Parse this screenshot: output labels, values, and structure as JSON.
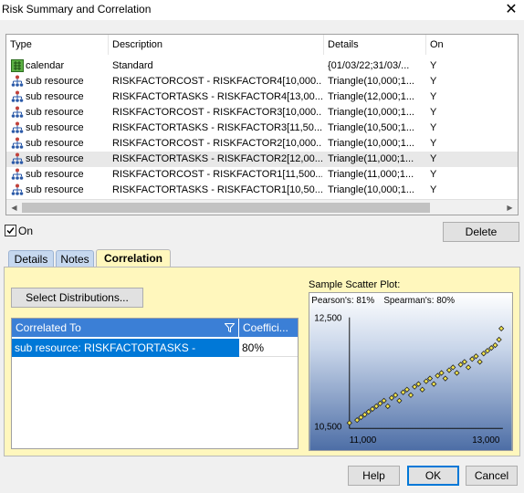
{
  "window": {
    "title": "Risk Summary and Correlation",
    "close_glyph": "✕"
  },
  "table": {
    "columns": [
      "Type",
      "Description",
      "Details",
      "On"
    ],
    "rows": [
      {
        "type": "calendar",
        "icon": "calendar-icon",
        "description": "Standard",
        "details": "{01/03/22;31/03/...",
        "on": "Y"
      },
      {
        "type": "sub resource",
        "icon": "sub-resource-icon",
        "description": "RISKFACTORCOST - RISKFACTOR4[10,000...",
        "details": "Triangle(10,000;1...",
        "on": "Y"
      },
      {
        "type": "sub resource",
        "icon": "sub-resource-icon",
        "description": "RISKFACTORTASKS - RISKFACTOR4[13,00...",
        "details": "Triangle(12,000;1...",
        "on": "Y"
      },
      {
        "type": "sub resource",
        "icon": "sub-resource-icon",
        "description": "RISKFACTORCOST - RISKFACTOR3[10,000...",
        "details": "Triangle(10,000;1...",
        "on": "Y"
      },
      {
        "type": "sub resource",
        "icon": "sub-resource-icon",
        "description": "RISKFACTORTASKS - RISKFACTOR3[11,50...",
        "details": "Triangle(10,500;1...",
        "on": "Y"
      },
      {
        "type": "sub resource",
        "icon": "sub-resource-icon",
        "description": "RISKFACTORCOST - RISKFACTOR2[10,000...",
        "details": "Triangle(10,000;1...",
        "on": "Y"
      },
      {
        "type": "sub resource",
        "icon": "sub-resource-icon",
        "description": "RISKFACTORTASKS - RISKFACTOR2[12,00...",
        "details": "Triangle(11,000;1...",
        "on": "Y",
        "selected": true
      },
      {
        "type": "sub resource",
        "icon": "sub-resource-icon",
        "description": "RISKFACTORCOST - RISKFACTOR1[11,500...",
        "details": "Triangle(11,000;1...",
        "on": "Y"
      },
      {
        "type": "sub resource",
        "icon": "sub-resource-icon",
        "description": "RISKFACTORTASKS - RISKFACTOR1[10,50...",
        "details": "Triangle(10,000;1...",
        "on": "Y"
      }
    ]
  },
  "on_checkbox": {
    "label": "On",
    "checked": true
  },
  "delete_label": "Delete",
  "tabs": [
    {
      "label": "Details",
      "active": false
    },
    {
      "label": "Notes",
      "active": false
    },
    {
      "label": "Correlation",
      "active": true
    }
  ],
  "select_distributions_label": "Select Distributions...",
  "corr_grid": {
    "headers": [
      "Correlated To",
      "Coeffici..."
    ],
    "rows": [
      {
        "correlated_to": "sub resource: RISKFACTORTASKS - RISKFACT...",
        "coefficient": "80%"
      }
    ]
  },
  "scatter": {
    "label": "Sample Scatter Plot:",
    "pearson": "Pearson's: 81%",
    "spearman": "Spearman's: 80%",
    "y_top": "12,500",
    "y_bottom": "10,500",
    "x_left": "11,000",
    "x_right": "13,000"
  },
  "chart_data": {
    "type": "scatter",
    "xlim": [
      11000,
      13000
    ],
    "ylim": [
      10500,
      12500
    ],
    "points": [
      [
        11000,
        10600
      ],
      [
        11100,
        10650
      ],
      [
        11150,
        10700
      ],
      [
        11200,
        10750
      ],
      [
        11250,
        10800
      ],
      [
        11300,
        10850
      ],
      [
        11350,
        10900
      ],
      [
        11400,
        10950
      ],
      [
        11450,
        11000
      ],
      [
        11500,
        10900
      ],
      [
        11550,
        11050
      ],
      [
        11600,
        11100
      ],
      [
        11650,
        11000
      ],
      [
        11700,
        11150
      ],
      [
        11750,
        11200
      ],
      [
        11800,
        11100
      ],
      [
        11850,
        11250
      ],
      [
        11900,
        11300
      ],
      [
        11950,
        11200
      ],
      [
        12000,
        11350
      ],
      [
        12050,
        11400
      ],
      [
        12100,
        11300
      ],
      [
        12150,
        11450
      ],
      [
        12200,
        11500
      ],
      [
        12250,
        11400
      ],
      [
        12300,
        11550
      ],
      [
        12350,
        11600
      ],
      [
        12400,
        11500
      ],
      [
        12450,
        11650
      ],
      [
        12500,
        11700
      ],
      [
        12550,
        11600
      ],
      [
        12600,
        11750
      ],
      [
        12650,
        11800
      ],
      [
        12700,
        11700
      ],
      [
        12750,
        11850
      ],
      [
        12800,
        11900
      ],
      [
        12850,
        11950
      ],
      [
        12900,
        12000
      ],
      [
        12950,
        12100
      ],
      [
        12980,
        12300
      ]
    ]
  },
  "buttons": {
    "help": "Help",
    "ok": "OK",
    "cancel": "Cancel"
  },
  "colors": {
    "panel": "#fff7bd",
    "grid_header": "#3b7fd6",
    "selection": "#0078d7",
    "plot_bg_top": "#ffffff",
    "plot_bg_bottom": "#4d6ea6",
    "point": "#f4e64d"
  }
}
